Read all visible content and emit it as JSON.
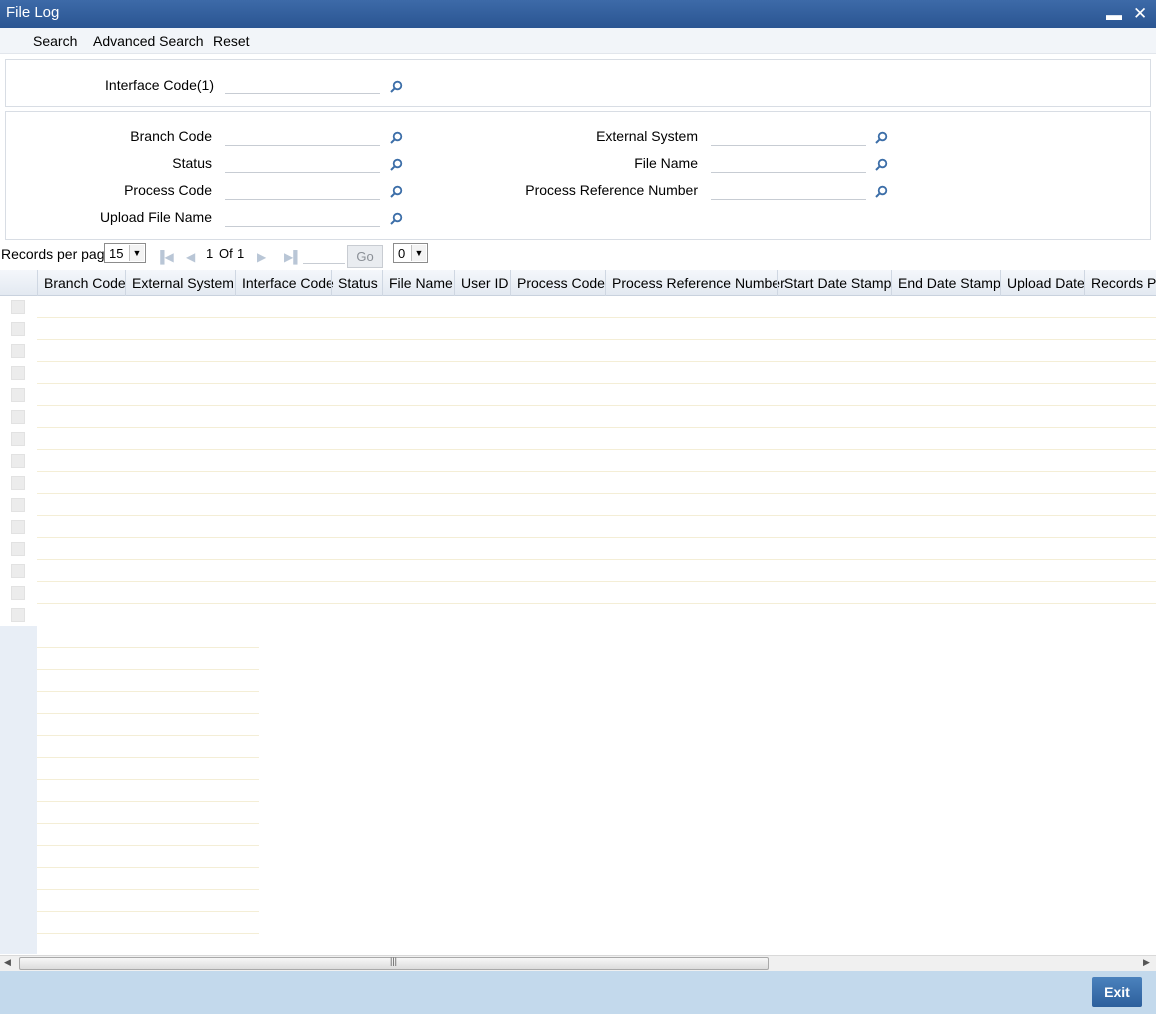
{
  "window": {
    "title": "File Log",
    "minimize_glyph": "▬",
    "close_glyph": "✕"
  },
  "menu": {
    "search": "Search",
    "advanced_search": "Advanced Search",
    "reset": "Reset"
  },
  "top_panel": {
    "interface_code_label": "Interface Code(1)",
    "interface_code_value": ""
  },
  "criteria": {
    "branch_code_label": "Branch Code",
    "status_label": "Status",
    "process_code_label": "Process Code",
    "upload_file_name_label": "Upload File Name",
    "external_system_label": "External System",
    "file_name_label": "File Name",
    "process_reference_number_label": "Process Reference Number",
    "branch_code_value": "",
    "status_value": "",
    "process_code_value": "",
    "upload_file_name_value": "",
    "external_system_value": "",
    "file_name_value": "",
    "process_reference_number_value": ""
  },
  "pager": {
    "records_per_page_label": "Records per page",
    "records_per_page_value": "15",
    "page_current": "1",
    "page_of": "Of",
    "page_total": "1",
    "go_label": "Go",
    "extra_select_value": "0"
  },
  "grid": {
    "columns": [
      "Branch Code",
      "External System",
      "Interface Code",
      "Status",
      "File Name",
      "User ID",
      "Process Code",
      "Process Reference Number",
      "Start Date Stamp",
      "End Date Stamp",
      "Upload Date",
      "Records Pr"
    ],
    "row_count": 15
  },
  "footer": {
    "exit_label": "Exit"
  },
  "colors": {
    "titlebar": "#2a5592",
    "footer": "#c3d9ec",
    "exit_button": "#3a6eaa"
  }
}
